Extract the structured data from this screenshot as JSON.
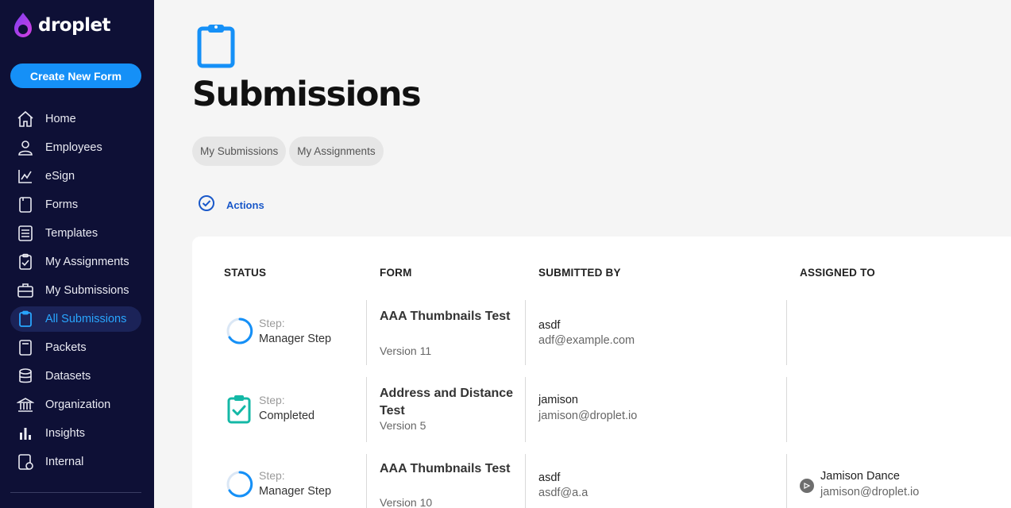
{
  "app": {
    "brand": "droplet",
    "brand_color": "#8a3ffc"
  },
  "sidebar": {
    "create_label": "Create New Form",
    "items": [
      {
        "label": "Home",
        "icon": "home-icon"
      },
      {
        "label": "Employees",
        "icon": "person-icon"
      },
      {
        "label": "eSign",
        "icon": "signature-icon"
      },
      {
        "label": "Forms",
        "icon": "form-icon"
      },
      {
        "label": "Templates",
        "icon": "template-icon"
      },
      {
        "label": "My Assignments",
        "icon": "clipboard-check-icon"
      },
      {
        "label": "My Submissions",
        "icon": "briefcase-icon"
      },
      {
        "label": "All Submissions",
        "icon": "clipboard-icon",
        "active": true
      },
      {
        "label": "Packets",
        "icon": "packet-icon"
      },
      {
        "label": "Datasets",
        "icon": "database-icon"
      },
      {
        "label": "Organization",
        "icon": "bank-icon"
      },
      {
        "label": "Insights",
        "icon": "bar-chart-icon"
      },
      {
        "label": "Internal",
        "icon": "internal-icon"
      }
    ]
  },
  "page": {
    "title": "Submissions",
    "icon": "clipboard-icon",
    "tabs": [
      "My Submissions",
      "My Assignments"
    ],
    "actions_label": "Actions"
  },
  "table": {
    "columns": [
      "STATUS",
      "FORM",
      "SUBMITTED BY",
      "ASSIGNED TO"
    ],
    "rows": [
      {
        "status_icon": "progress-ring-icon",
        "step_label": "Step:",
        "step_name": "Manager Step",
        "form_name": "AAA Thumbnails Test",
        "form_version": "Version 11",
        "submitted_name": "asdf",
        "submitted_email": "adf@example.com",
        "assigned_name": "",
        "assigned_email": ""
      },
      {
        "status_icon": "completed-check-icon",
        "step_label": "Step:",
        "step_name": "Completed",
        "form_name": "Address and Distance Test",
        "form_version": "Version 5",
        "submitted_name": "jamison",
        "submitted_email": "jamison@droplet.io",
        "assigned_name": "",
        "assigned_email": ""
      },
      {
        "status_icon": "progress-ring-icon",
        "step_label": "Step:",
        "step_name": "Manager Step",
        "form_name": "AAA Thumbnails Test",
        "form_version": "Version 10",
        "submitted_name": "asdf",
        "submitted_email": "asdf@a.a",
        "assigned_name": "Jamison Dance",
        "assigned_email": "jamison@droplet.io"
      }
    ]
  },
  "colors": {
    "sidebar_bg": "#0e1036",
    "accent": "#1590f7",
    "active_text": "#29a6ff",
    "completed": "#14b8a6"
  }
}
